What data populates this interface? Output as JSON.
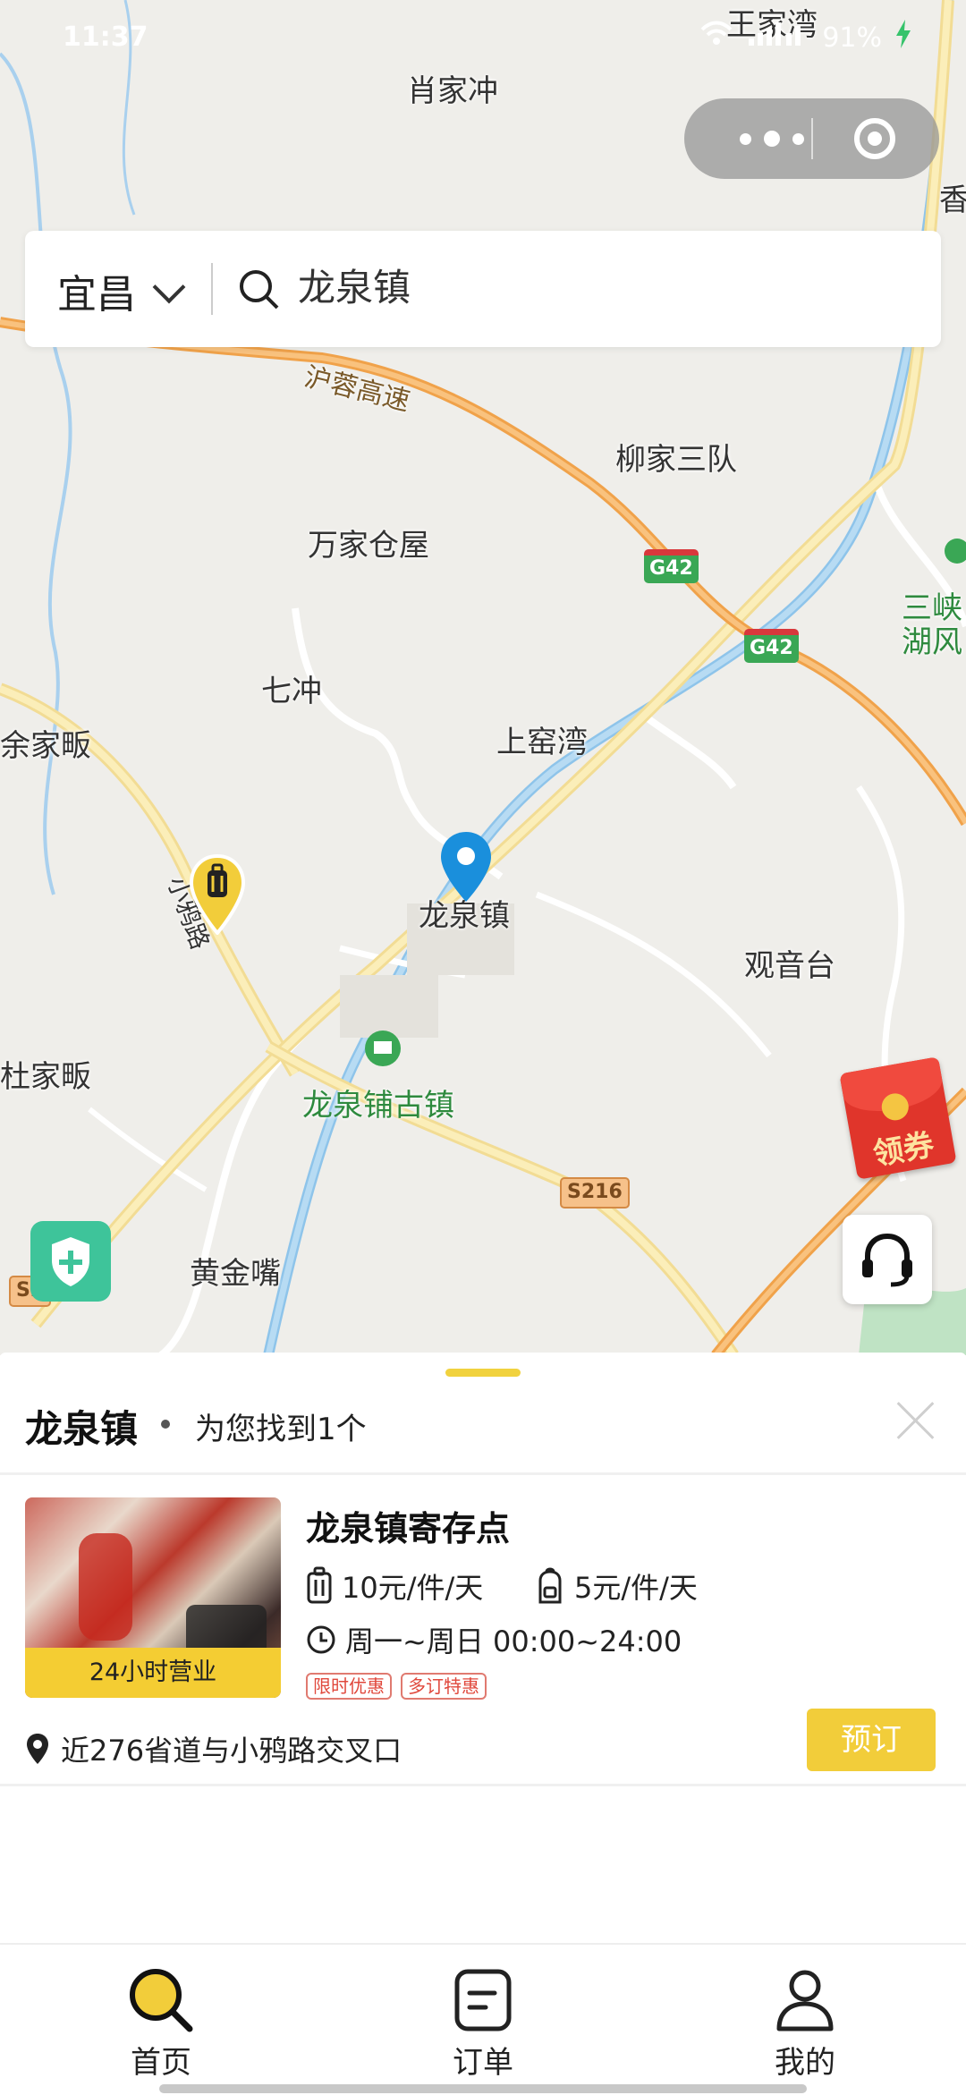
{
  "status_bar": {
    "time": "11:37",
    "battery": "91%"
  },
  "map": {
    "places": {
      "wangjiawan": "王家湾",
      "xiaojiachong": "肖家冲",
      "xiang": "香",
      "hurong_highway": "沪蓉高速",
      "liujiasandui": "柳家三队",
      "wanjiacangwu": "万家仓屋",
      "sanxia_1": "三峡",
      "sanxia_2": "湖风",
      "qichong": "七冲",
      "shangyaowan": "上窑湾",
      "yujiafan": "余家畈",
      "longquanzhen": "龙泉镇",
      "guanyintai": "观音台",
      "xiaoya_road": "小鸦路",
      "dujiafan": "杜家畈",
      "longquanpu": "龙泉铺古镇",
      "huangjinzui": "黄金嘴"
    },
    "shields": {
      "g42_a": "G42",
      "g42_b": "G42",
      "s216": "S216",
      "s2_partial": "S2"
    },
    "coupon_label": "领券"
  },
  "search": {
    "city": "宜昌",
    "query": "龙泉镇"
  },
  "sheet": {
    "location": "龙泉镇",
    "found_text": "为您找到1个",
    "store": {
      "name": "龙泉镇寄存点",
      "badge": "24小时营业",
      "price_large": "10元/件/天",
      "price_small": "5元/件/天",
      "hours": "周一~周日 00:00~24:00",
      "tags": [
        "限时优惠",
        "多订特惠"
      ],
      "address": "近276省道与小鸦路交叉口",
      "book_label": "预订"
    }
  },
  "tabs": [
    {
      "label": "首页",
      "active": true
    },
    {
      "label": "订单",
      "active": false
    },
    {
      "label": "我的",
      "active": false
    }
  ],
  "colors": {
    "accent": "#f2cd3a",
    "map_bg": "#efeeea",
    "pin": "#1a8fdc",
    "coupon": "#e0352b"
  }
}
